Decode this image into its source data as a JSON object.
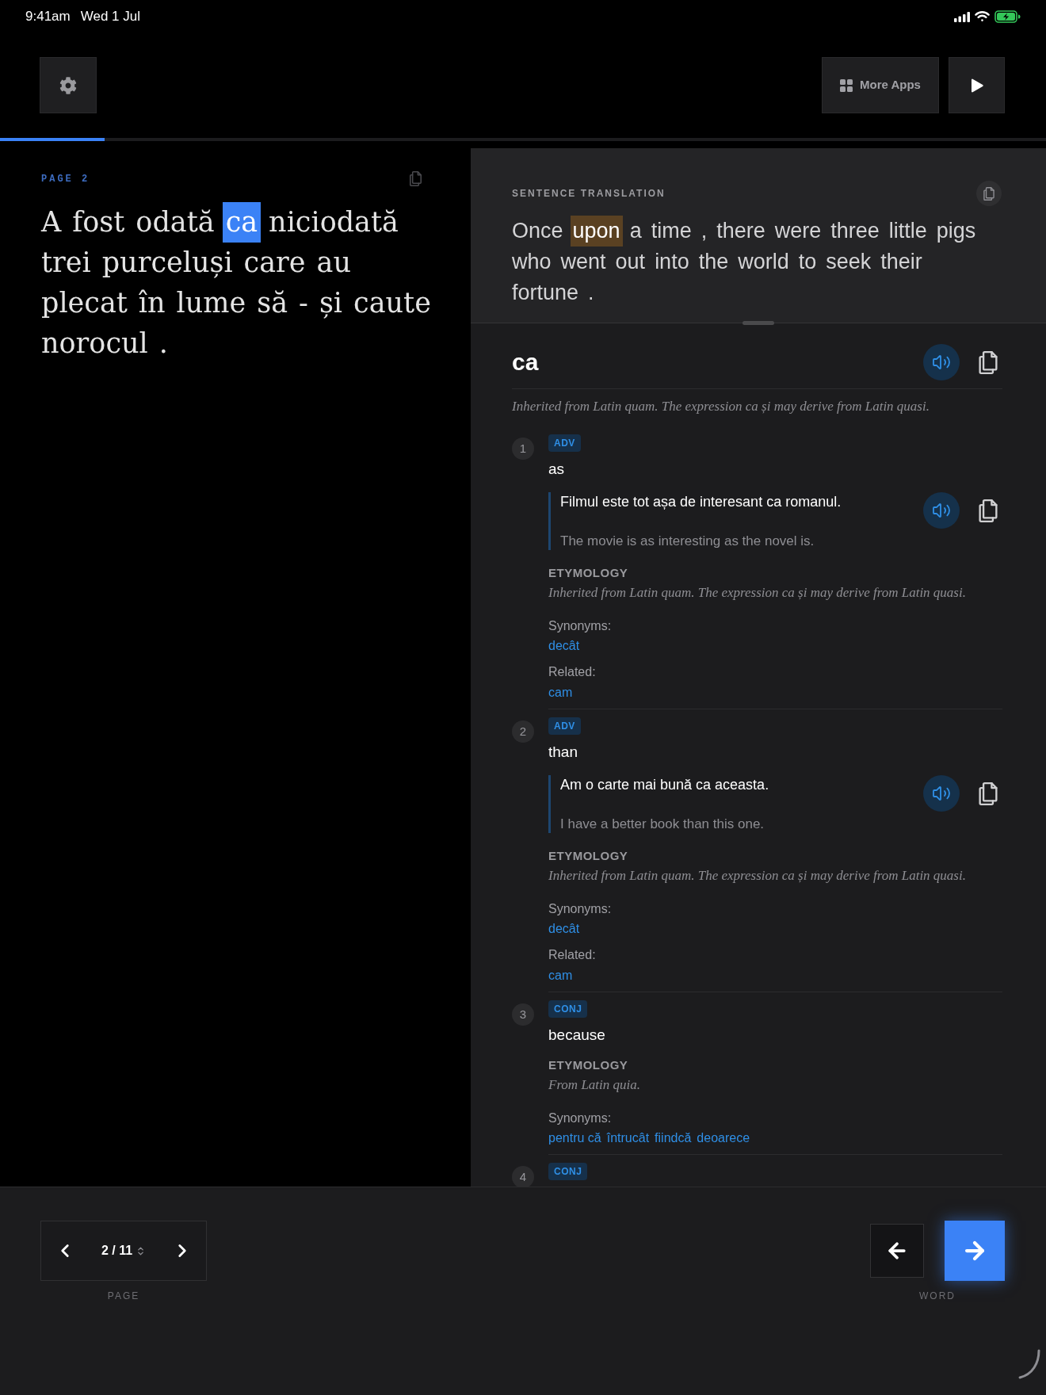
{
  "status_bar": {
    "time": "9:41am",
    "date": "Wed 1 Jul"
  },
  "toolbar": {
    "more_apps": "More Apps"
  },
  "progress": {
    "level": 0.1
  },
  "reader": {
    "page_label": "PAGE 2",
    "tokens": [
      {
        "text": "A",
        "selected": false
      },
      {
        "text": "fost",
        "selected": false
      },
      {
        "text": "odată",
        "selected": false
      },
      {
        "text": "ca",
        "selected": true
      },
      {
        "text": "niciodată",
        "selected": false
      },
      {
        "text": "trei",
        "selected": false
      },
      {
        "text": "purceluși",
        "selected": false
      },
      {
        "text": "care",
        "selected": false
      },
      {
        "text": "au",
        "selected": false
      },
      {
        "text": "plecat",
        "selected": false
      },
      {
        "text": "în",
        "selected": false
      },
      {
        "text": "lume",
        "selected": false
      },
      {
        "text": "să",
        "selected": false
      },
      {
        "text": "-",
        "selected": false
      },
      {
        "text": "și",
        "selected": false
      },
      {
        "text": "caute",
        "selected": false
      },
      {
        "text": "norocul",
        "selected": false
      },
      {
        "text": ".",
        "selected": false
      }
    ]
  },
  "translation": {
    "heading": "SENTENCE TRANSLATION",
    "tokens": [
      {
        "text": "Once",
        "selected": false
      },
      {
        "text": "upon",
        "selected": true
      },
      {
        "text": "a",
        "selected": false
      },
      {
        "text": "time",
        "selected": false
      },
      {
        "text": ",",
        "selected": false
      },
      {
        "text": "there",
        "selected": false
      },
      {
        "text": "were",
        "selected": false
      },
      {
        "text": "three",
        "selected": false
      },
      {
        "text": "little",
        "selected": false
      },
      {
        "text": "pigs",
        "selected": false
      },
      {
        "text": "who",
        "selected": false
      },
      {
        "text": "went",
        "selected": false
      },
      {
        "text": "out",
        "selected": false
      },
      {
        "text": "into",
        "selected": false
      },
      {
        "text": "the",
        "selected": false
      },
      {
        "text": "world",
        "selected": false
      },
      {
        "text": "to",
        "selected": false
      },
      {
        "text": "seek",
        "selected": false
      },
      {
        "text": "their",
        "selected": false
      },
      {
        "text": "fortune",
        "selected": false
      },
      {
        "text": ".",
        "selected": false
      }
    ]
  },
  "entry": {
    "headword": "ca",
    "etymology": "Inherited from Latin quam. The expression ca și may derive from Latin quasi.",
    "senses": [
      {
        "number": "1",
        "pos": "ADV",
        "definition": "as",
        "example": {
          "text": "Filmul este tot așa de interesant ca romanul.",
          "translation": "The movie is as interesting as the novel is."
        },
        "etymology_label": "ETYMOLOGY",
        "etymology": "Inherited from Latin quam. The expression ca și may derive from Latin quasi.",
        "synonyms_label": "Synonyms:",
        "synonyms": [
          "decât"
        ],
        "related_label": "Related:",
        "related": [
          "cam"
        ]
      },
      {
        "number": "2",
        "pos": "ADV",
        "definition": "than",
        "example": {
          "text": "Am o carte mai bună ca aceasta.",
          "translation": "I have a better book than this one."
        },
        "etymology_label": "ETYMOLOGY",
        "etymology": "Inherited from Latin quam. The expression ca și may derive from Latin quasi.",
        "synonyms_label": "Synonyms:",
        "synonyms": [
          "decât"
        ],
        "related_label": "Related:",
        "related": [
          "cam"
        ]
      },
      {
        "number": "3",
        "pos": "CONJ",
        "definition": "because",
        "etymology_label": "ETYMOLOGY",
        "etymology": "From Latin quia.",
        "synonyms_label": "Synonyms:",
        "synonyms": [
          "pentru că",
          "întrucât",
          "fiindcă",
          "deoarece"
        ]
      },
      {
        "number": "4",
        "pos": "CONJ"
      }
    ]
  },
  "pager": {
    "value": "2 / 11",
    "label": "PAGE"
  },
  "word_nav": {
    "label": "WORD"
  }
}
